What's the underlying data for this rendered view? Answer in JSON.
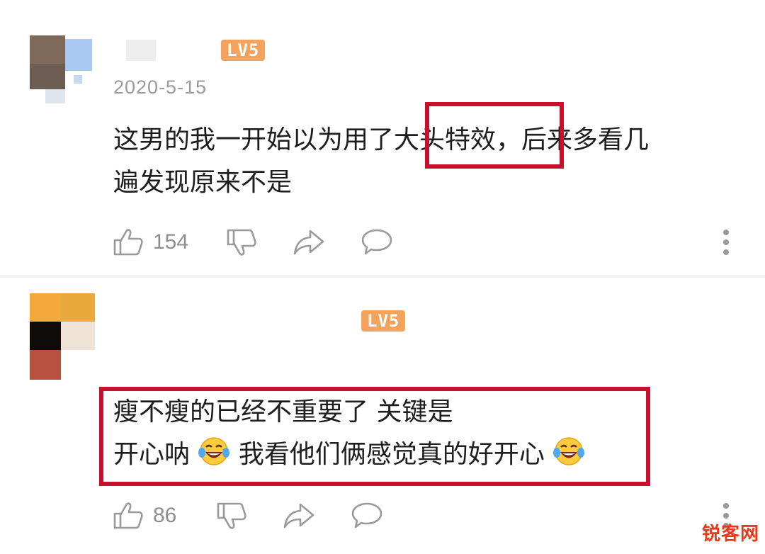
{
  "comments": [
    {
      "level": "LV5",
      "date": "2020-5-15",
      "text_part1": "这男的我一开始以为用了",
      "text_highlight": "大头特效",
      "text_part2": "，后来多看几",
      "text_line2": "遍发现原来不是",
      "likes": "154",
      "avatar_icon": "user-avatar-icon"
    },
    {
      "level": "LV5",
      "text_line1": "瘦不瘦的已经不重要了 关键是",
      "text_line2a": "开心呐",
      "text_line2b": " 我看他们俩感觉真的好开心",
      "likes": "86",
      "emoji": "laughing-tears-emoji"
    }
  ],
  "watermark": "锐客网",
  "colors": {
    "highlight_border": "#c8102e",
    "level_badge": "#f4a35d",
    "meta_text": "#9b9b9b"
  }
}
